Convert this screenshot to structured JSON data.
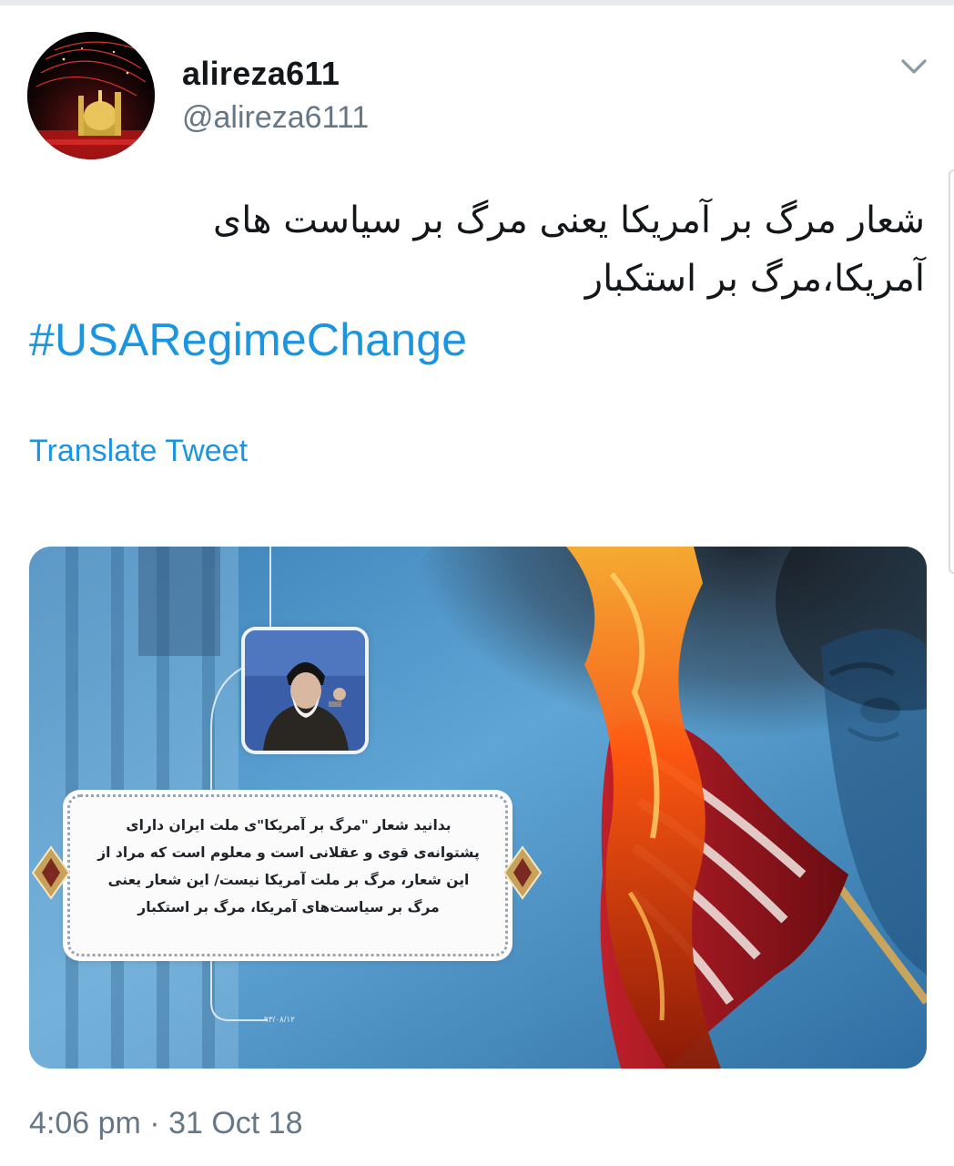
{
  "user": {
    "display_name": "alireza611",
    "handle": "@alireza6111"
  },
  "tweet": {
    "text": "شعار مرگ بر آمریکا یعنی مرگ بر سیاست های آمریکا،مرگ بر استکبار",
    "hashtag": "#USARegimeChange",
    "translate_label": "Translate Tweet",
    "timestamp": "4:06 pm · 31 Oct 18"
  },
  "media": {
    "quote_lines": [
      "بدانید شعار \"مرگ بر آمریکا\"ی ملت ایران دارای",
      "پشتوانه‌ی قوی و عقلانی است و معلوم است که مراد از",
      "این شعار، مرگ بر ملت آمریکا نیست/ این شعار یعنی",
      "مرگ بر سیاست‌های آمریکا، مرگ بر استکبار"
    ],
    "date_caption": "۹۳/۰۸/۱۲"
  },
  "icons": {
    "menu": "chevron-down-icon"
  },
  "colors": {
    "link": "#1b95e0",
    "secondary_text": "#657786",
    "primary_text": "#14171a"
  }
}
